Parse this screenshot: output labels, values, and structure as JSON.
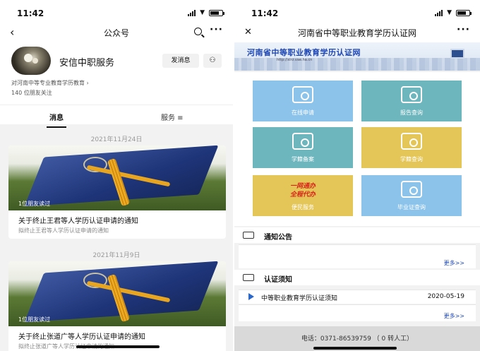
{
  "left": {
    "status": {
      "time": "11:42"
    },
    "nav": {
      "title": "公众号"
    },
    "profile": {
      "name": "安信中职服务",
      "follow_btn": "发消息",
      "description": "对河南中等专业教育学历教育",
      "followers": "140 位朋友关注"
    },
    "tabs": {
      "messages": "消息",
      "services": "服务 ≡"
    },
    "articles": [
      {
        "date": "2021年11月24日",
        "read": "1位朋友读过",
        "title": "关于终止王君等人学历认证申请的通知",
        "subtitle": "拟终止王君等人学历认证申请的通知"
      },
      {
        "date": "2021年11月9日",
        "read": "1位朋友读过",
        "title": "关于终止张道广等人学历认证申请的通知",
        "subtitle": "拟终止张道广等人学历认证申请的通知"
      }
    ]
  },
  "right": {
    "status": {
      "time": "11:42"
    },
    "nav": {
      "title": "河南省中等职业教育学历认证网"
    },
    "banner": {
      "title": "河南省中等职业教育学历认证网",
      "url": "http://xlrz.vae.ha.cn"
    },
    "tiles": [
      {
        "label": "在线申请",
        "color": "#8cc3ea"
      },
      {
        "label": "报告查询",
        "color": "#6db6bd"
      },
      {
        "label": "学籍备案",
        "color": "#6db6bd"
      },
      {
        "label": "学籍查询",
        "color": "#e4c557"
      },
      {
        "label": "便民服务",
        "color": "#e4c557",
        "line1": "一网通办",
        "line2": "全程代办"
      },
      {
        "label": "毕业证查询",
        "color": "#8cc3ea"
      }
    ],
    "notice": {
      "title": "通知公告",
      "more": "更多>>"
    },
    "guide": {
      "title": "认证须知",
      "item": {
        "text": "中等职业教育学历认证须知",
        "date": "2020-05-19"
      },
      "more": "更多>>"
    },
    "footer": {
      "phone": "电话：0371-86539759 （ 0 转人工）"
    }
  }
}
